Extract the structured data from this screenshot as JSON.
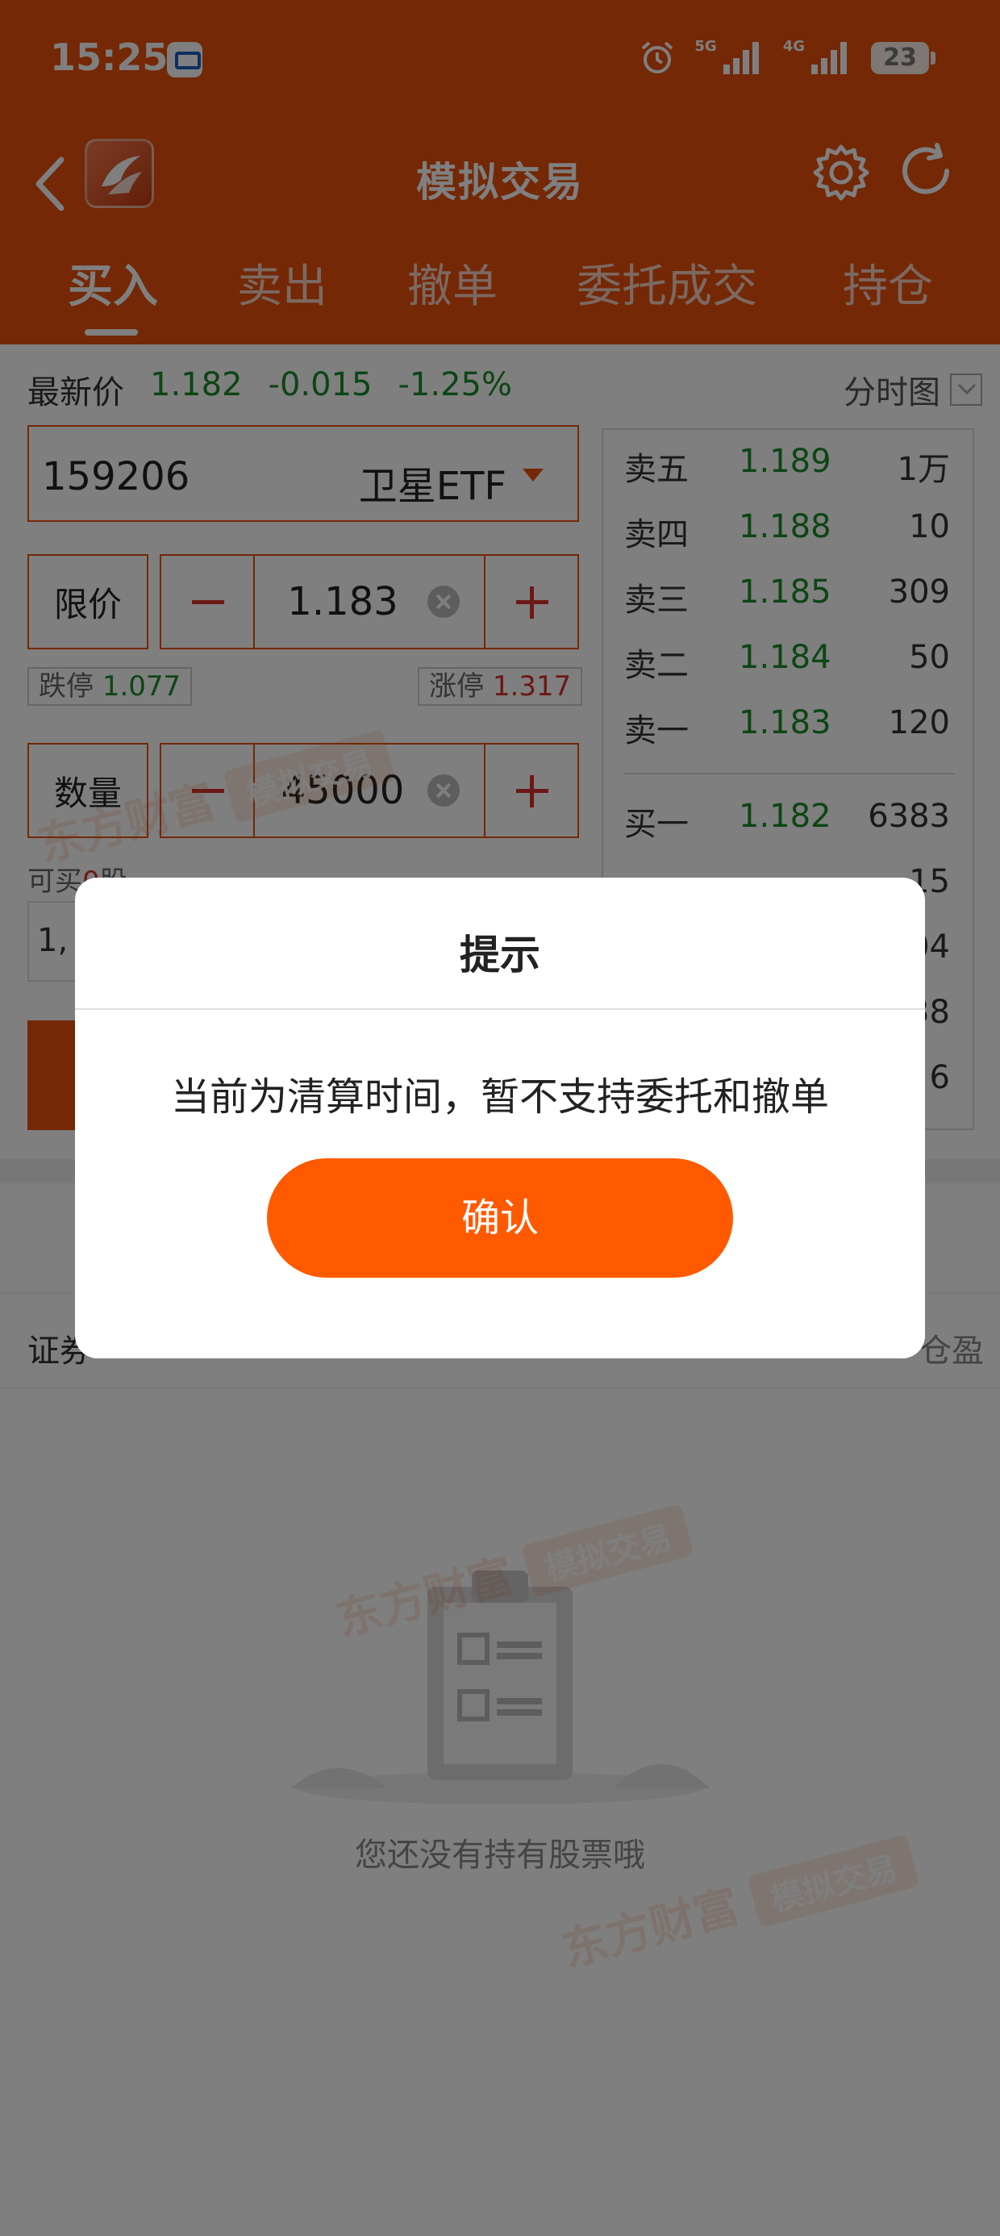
{
  "status_bar": {
    "time": "15:25",
    "network_5g": "5G",
    "network_4g": "4G",
    "battery": "23"
  },
  "nav": {
    "title": "模拟交易"
  },
  "tabs": [
    {
      "label": "买入",
      "active": true
    },
    {
      "label": "卖出",
      "active": false
    },
    {
      "label": "撤单",
      "active": false
    },
    {
      "label": "委托成交",
      "active": false
    },
    {
      "label": "持仓",
      "active": false
    }
  ],
  "quote": {
    "label": "最新价",
    "price": "1.182",
    "change": "-0.015",
    "change_pct": "-1.25%",
    "chart_link": "分时图"
  },
  "stock": {
    "code": "159206",
    "name": "卫星ETF"
  },
  "price_field": {
    "label": "限价",
    "value": "1.183"
  },
  "limits": {
    "down_label": "跌停",
    "down_value": "1.077",
    "up_label": "涨停",
    "up_value": "1.317"
  },
  "quantity_field": {
    "label": "数量",
    "value": "45000"
  },
  "available": {
    "prefix": "可买",
    "value": "0",
    "suffix": "股"
  },
  "hidden_input_partial": "1,",
  "orderbook": {
    "asks": [
      {
        "label": "卖五",
        "price": "1.189",
        "volume": "1万"
      },
      {
        "label": "卖四",
        "price": "1.188",
        "volume": "10"
      },
      {
        "label": "卖三",
        "price": "1.185",
        "volume": "309"
      },
      {
        "label": "卖二",
        "price": "1.184",
        "volume": "50"
      },
      {
        "label": "卖一",
        "price": "1.183",
        "volume": "120"
      }
    ],
    "bids": [
      {
        "label": "买一",
        "price": "1.182",
        "volume": "6383"
      },
      {
        "label": "",
        "price": "",
        "volume": "15"
      },
      {
        "label": "",
        "price": "",
        "volume": "04"
      },
      {
        "label": "",
        "price": "",
        "volume": "38"
      },
      {
        "label": "",
        "price": "",
        "volume": "6"
      }
    ]
  },
  "holdings": {
    "left_partial": "证券",
    "right_partial": "仓盈",
    "empty_text": "您还没有持有股票哦"
  },
  "watermark": {
    "brand": "东方财富",
    "tag": "模拟交易"
  },
  "dialog": {
    "title": "提示",
    "message": "当前为清算时间，暂不支持委托和撤单",
    "confirm": "确认"
  },
  "colors": {
    "accent": "#E8500C",
    "button": "#FF5A00",
    "up": "#d9302c",
    "down": "#1a8a2a"
  }
}
